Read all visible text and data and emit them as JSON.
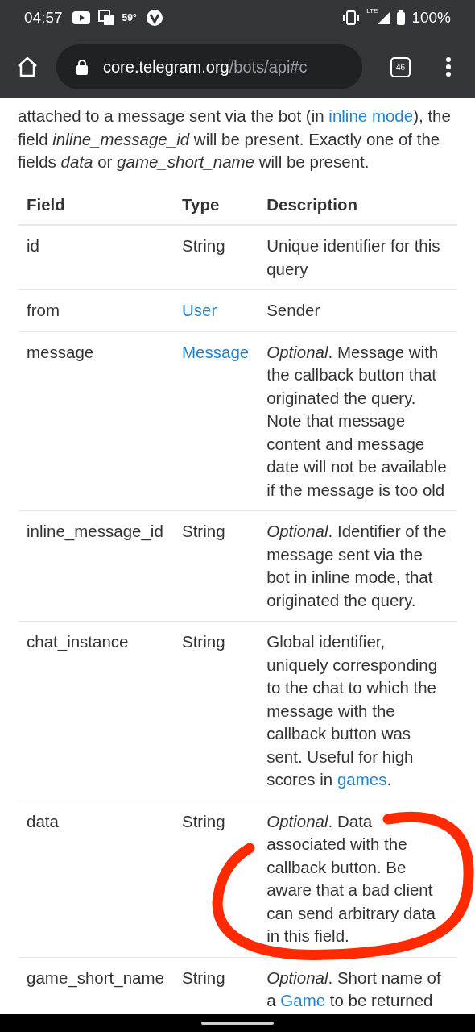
{
  "status_bar": {
    "time": "04:57",
    "temperature": "59°",
    "network": "LTE",
    "battery": "100%"
  },
  "address_bar": {
    "host": "core.telegram.org",
    "path": "/bots/api#c",
    "tab_count": "46"
  },
  "intro": [
    {
      "kind": "text",
      "text": "attached to a message sent via the bot (in "
    },
    {
      "kind": "link",
      "text": "inline mode"
    },
    {
      "kind": "text",
      "text": "), the field *inline_message_id* will be present. Exactly one of the fields *data* or *game_short_name* will be present."
    }
  ],
  "table": {
    "columns": [
      "Field",
      "Type",
      "Description"
    ],
    "rows": [
      {
        "field": "id",
        "type": {
          "text": "String",
          "link": false
        },
        "description": [
          {
            "kind": "text",
            "text": "Unique identifier for this query"
          }
        ],
        "annotated": false
      },
      {
        "field": "from",
        "type": {
          "text": "User",
          "link": true
        },
        "description": [
          {
            "kind": "text",
            "text": "Sender"
          }
        ],
        "annotated": false
      },
      {
        "field": "message",
        "type": {
          "text": "Message",
          "link": true
        },
        "description": [
          {
            "kind": "text",
            "text": "*Optional*. Message with the callback button that originated the query. Note that message content and message date will not be available if the message is too old"
          }
        ],
        "annotated": false
      },
      {
        "field": "inline_message_id",
        "type": {
          "text": "String",
          "link": false
        },
        "description": [
          {
            "kind": "text",
            "text": "*Optional*. Identifier of the message sent via the bot in inline mode, that originated the query."
          }
        ],
        "annotated": false
      },
      {
        "field": "chat_instance",
        "type": {
          "text": "String",
          "link": false
        },
        "description": [
          {
            "kind": "text",
            "text": "Global identifier, uniquely corresponding to the chat to which the message with the callback button was sent. Useful for high scores in "
          },
          {
            "kind": "link",
            "text": "games"
          },
          {
            "kind": "text",
            "text": "."
          }
        ],
        "annotated": false
      },
      {
        "field": "data",
        "type": {
          "text": "String",
          "link": false
        },
        "description": [
          {
            "kind": "text",
            "text": "*Optional*. Data associated with the callback button. Be aware that a bad client can send arbitrary data in this field."
          }
        ],
        "annotated": true
      },
      {
        "field": "game_short_name",
        "type": {
          "text": "String",
          "link": false
        },
        "description": [
          {
            "kind": "text",
            "text": "*Optional*. Short name of a "
          },
          {
            "kind": "link",
            "text": "Game"
          },
          {
            "kind": "text",
            "text": " to be returned"
          }
        ],
        "annotated": false
      }
    ]
  }
}
